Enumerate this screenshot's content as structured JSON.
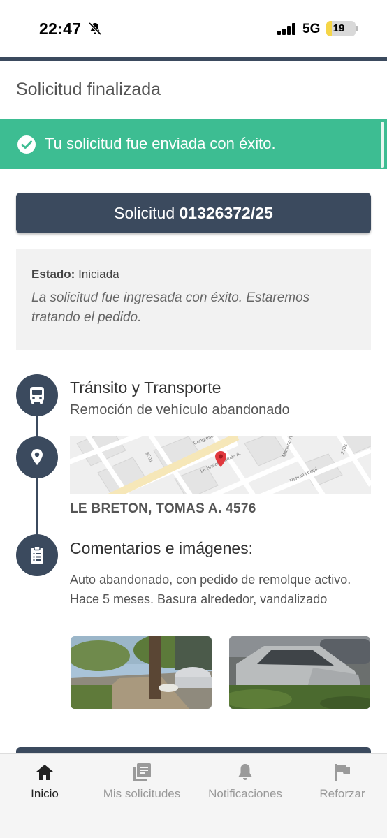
{
  "status_bar": {
    "time": "22:47",
    "network": "5G",
    "battery_level": "19",
    "battery_fraction": 0.19
  },
  "header": {
    "title": "Solicitud finalizada"
  },
  "banner": {
    "message": "Tu solicitud fue enviada con éxito."
  },
  "request": {
    "label": "Solicitud",
    "number": "01326372/25"
  },
  "state": {
    "label": "Estado:",
    "value": "Iniciada",
    "description": "La solicitud fue ingresada con éxito. Estaremos tratando el pedido."
  },
  "category": {
    "title": "Tránsito y Transporte",
    "subtitle": "Remoción de vehículo abandonado"
  },
  "location": {
    "address": "LE BRETON, TOMAS A. 4576",
    "map_labels": [
      "Congreso",
      "Le Breton, Tomas A.",
      "Mariano Acha",
      "Nahuel Huapi",
      "3501",
      "2701"
    ]
  },
  "comments": {
    "title": "Comentarios e imágenes:",
    "text": "Auto abandonado, con pedido de remolque activo. Hace 5 meses. Basura alrededor, vandalizado"
  },
  "tabs": [
    {
      "label": "Inicio",
      "icon": "home-icon",
      "active": true
    },
    {
      "label": "Mis solicitudes",
      "icon": "list-icon",
      "active": false
    },
    {
      "label": "Notificaciones",
      "icon": "bell-icon",
      "active": false
    },
    {
      "label": "Reforzar",
      "icon": "flag-icon",
      "active": false
    }
  ],
  "colors": {
    "primary": "#3b4a5e",
    "success": "#3dbd92",
    "map_pin": "#e0393e"
  }
}
